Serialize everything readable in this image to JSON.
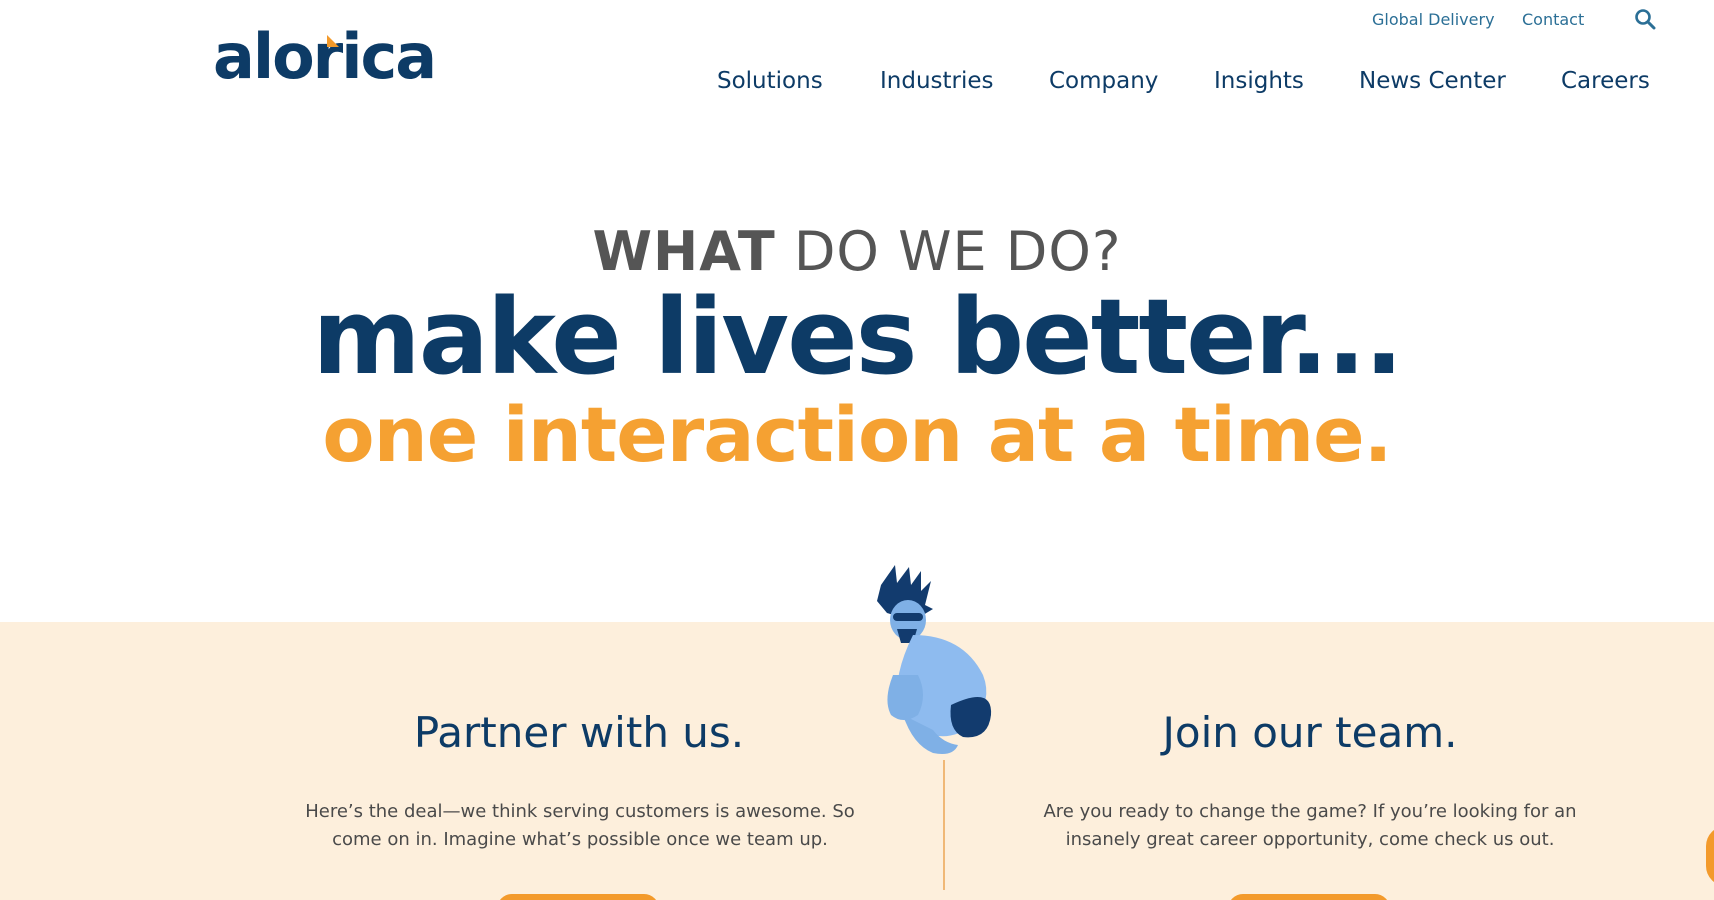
{
  "brand": {
    "logo_text": "alorica"
  },
  "utility_nav": {
    "global_delivery": "Global Delivery",
    "contact": "Contact"
  },
  "main_nav": {
    "items": [
      "Solutions",
      "Industries",
      "Company",
      "Insights",
      "News Center",
      "Careers"
    ]
  },
  "hero": {
    "eyebrow_bold": "WHAT",
    "eyebrow_rest": " DO WE DO?",
    "headline": "make lives better...",
    "subheadline": "one interaction at a time."
  },
  "partner": {
    "title": "Partner with us.",
    "text": "Here’s the deal—we think serving customers is awesome. So come on in. Imagine what’s possible once we team up."
  },
  "join": {
    "title": "Join our team.",
    "text": "Are you ready to change the game? If you’re looking for an insanely great career opportunity, come check us out."
  },
  "colors": {
    "brand_navy": "#0d3b66",
    "brand_orange": "#f39a2b",
    "band_cream": "#fdefdc"
  },
  "icons": {
    "search": "search-icon",
    "figure": "jumping-person-illustration"
  }
}
